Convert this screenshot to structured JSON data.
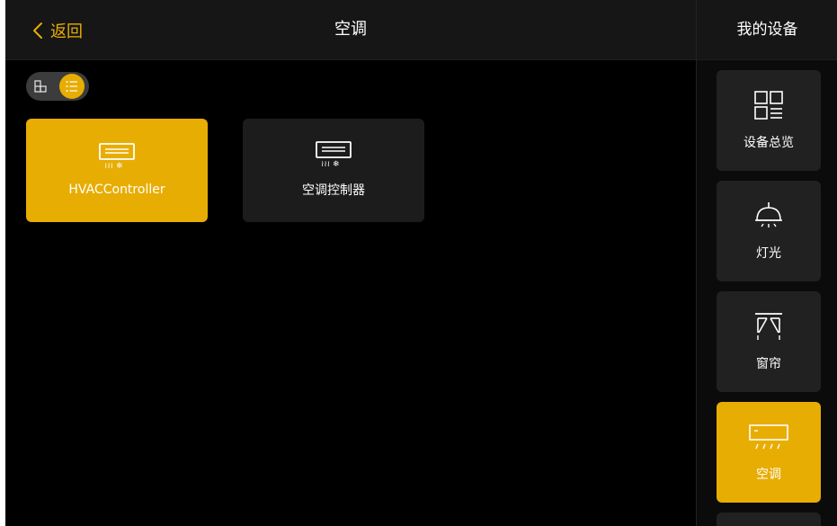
{
  "header": {
    "back_label": "返回",
    "title": "空调"
  },
  "sidebar": {
    "title": "我的设备",
    "items": [
      {
        "label": "设备总览",
        "icon": "grid-list-icon",
        "active": false
      },
      {
        "label": "灯光",
        "icon": "lamp-icon",
        "active": false
      },
      {
        "label": "窗帘",
        "icon": "curtain-icon",
        "active": false
      },
      {
        "label": "空调",
        "icon": "air-conditioner-icon",
        "active": true
      }
    ]
  },
  "view_toggle": {
    "options": [
      "grid-icon",
      "list-icon"
    ],
    "selected": "list"
  },
  "devices": [
    {
      "label": "HVACController",
      "icon": "air-conditioner-icon",
      "active": true
    },
    {
      "label": "空调控制器",
      "icon": "air-conditioner-icon",
      "active": false
    }
  ],
  "colors": {
    "accent": "#e8ad03",
    "card": "#1c1c1c",
    "background": "#000000",
    "header": "#161616"
  }
}
